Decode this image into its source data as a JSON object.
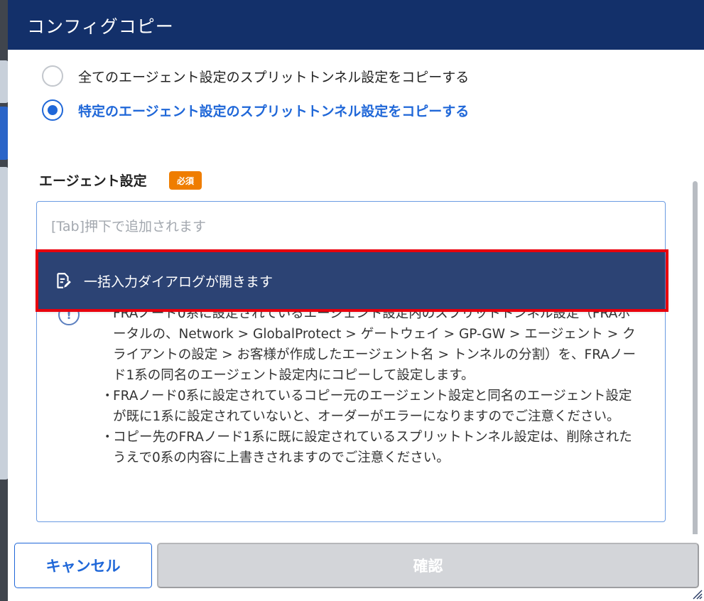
{
  "dialog": {
    "title": "コンフィグコピー"
  },
  "radio_options": [
    {
      "label": "全てのエージェント設定のスプリットトンネル設定をコピーする",
      "checked": false
    },
    {
      "label": "特定のエージェント設定のスプリットトンネル設定をコピーする",
      "checked": true
    }
  ],
  "agent_section": {
    "label": "エージェント設定",
    "required_badge": "必須",
    "input_placeholder": "[Tab]押下で追加されます",
    "input_value": ""
  },
  "tooltip": {
    "text": "一括入力ダイアログが開きます",
    "icon": "document-edit-icon"
  },
  "notes": {
    "icon": "info-icon",
    "items": [
      {
        "bullet": "",
        "text": "FRAノード0系に設定されているエージェント設定内のスプリットトンネル設定（FRAポータルの、Network > GlobalProtect > ゲートウェイ > GP-GW > エージェント > クライアントの設定 > お客様が作成したエージェント名 > トンネルの分割）を、FRAノード1系の同名のエージェント設定内にコピーして設定します。"
      },
      {
        "bullet": "・",
        "text": "FRAノード0系に設定されているコピー元のエージェント設定と同名のエージェント設定が既に1系に設定されていないと、オーダーがエラーになりますのでご注意ください。"
      },
      {
        "bullet": "・",
        "text": "コピー先のFRAノード1系に既に設定されているスプリットトンネル設定は、削除されたうえで0系の内容に上書きされますのでご注意ください。"
      }
    ]
  },
  "footer": {
    "cancel_label": "キャンセル",
    "confirm_label": "確認",
    "confirm_enabled": false
  },
  "colors": {
    "header_bg": "#13306a",
    "accent": "#1f67d8",
    "required_badge": "#ef7d00",
    "tooltip_bg": "#2c4374",
    "highlight": "#e8000d",
    "disabled_button": "#d3d5d9"
  }
}
